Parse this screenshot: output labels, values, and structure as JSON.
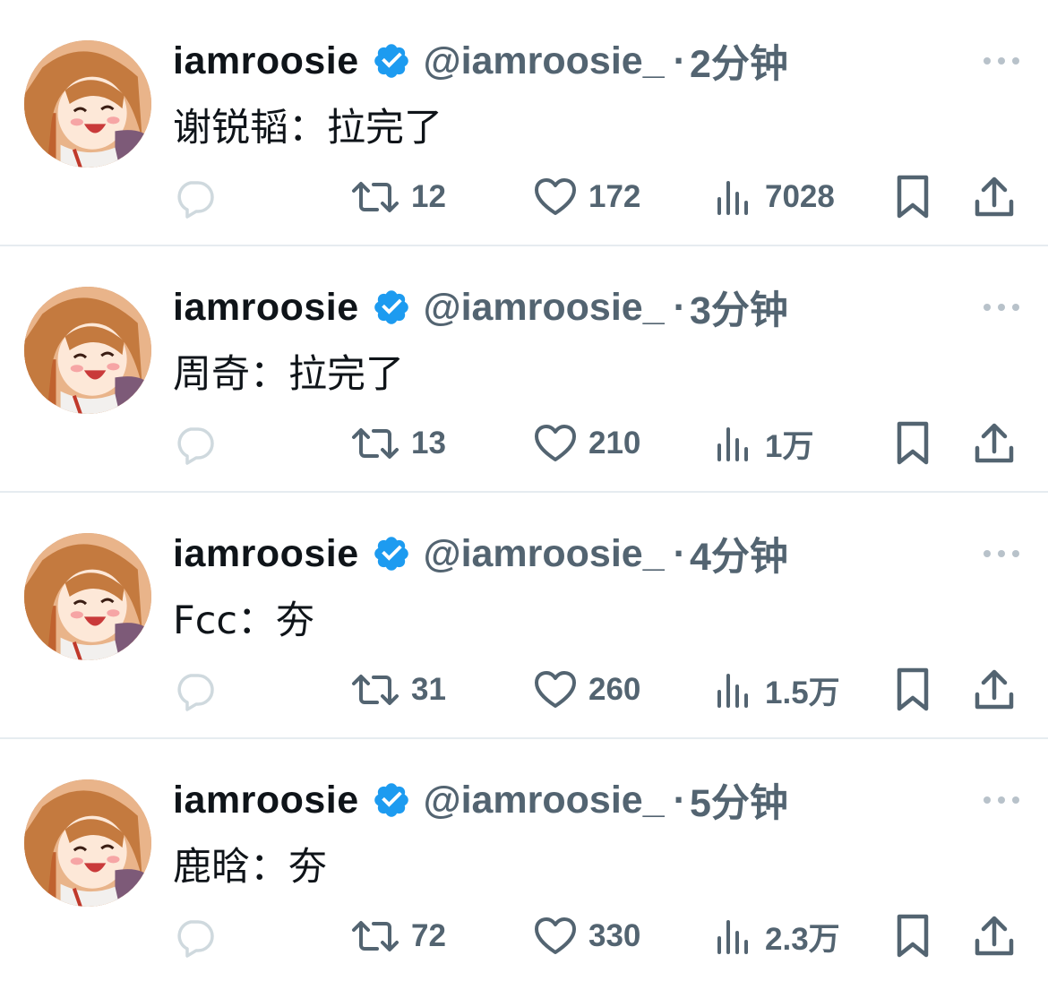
{
  "colors": {
    "text_primary": "#0f1419",
    "text_secondary": "#536471",
    "verified_blue": "#1d9bf0",
    "divider": "#e6ecf0"
  },
  "icons": {
    "reply": "reply-icon",
    "retweet": "retweet-icon",
    "like": "heart-icon",
    "views": "views-icon",
    "bookmark": "bookmark-icon",
    "share": "share-icon",
    "more": "more-icon",
    "verified": "verified-badge-icon"
  },
  "tweets": [
    {
      "display_name": "iamroosie",
      "handle": "@iamroosie_",
      "dot": "·",
      "time": "2分钟",
      "text": "谢锐韬：拉完了",
      "retweets": "12",
      "likes": "172",
      "views": "7028"
    },
    {
      "display_name": "iamroosie",
      "handle": "@iamroosie_",
      "dot": "·",
      "time": "3分钟",
      "text": "周奇：拉完了",
      "retweets": "13",
      "likes": "210",
      "views": "1万"
    },
    {
      "display_name": "iamroosie",
      "handle": "@iamroosie_",
      "dot": "·",
      "time": "4分钟",
      "text": "Fcc：夯",
      "retweets": "31",
      "likes": "260",
      "views": "1.5万"
    },
    {
      "display_name": "iamroosie",
      "handle": "@iamroosie_",
      "dot": "·",
      "time": "5分钟",
      "text": "鹿晗：夯",
      "retweets": "72",
      "likes": "330",
      "views": "2.3万"
    }
  ]
}
